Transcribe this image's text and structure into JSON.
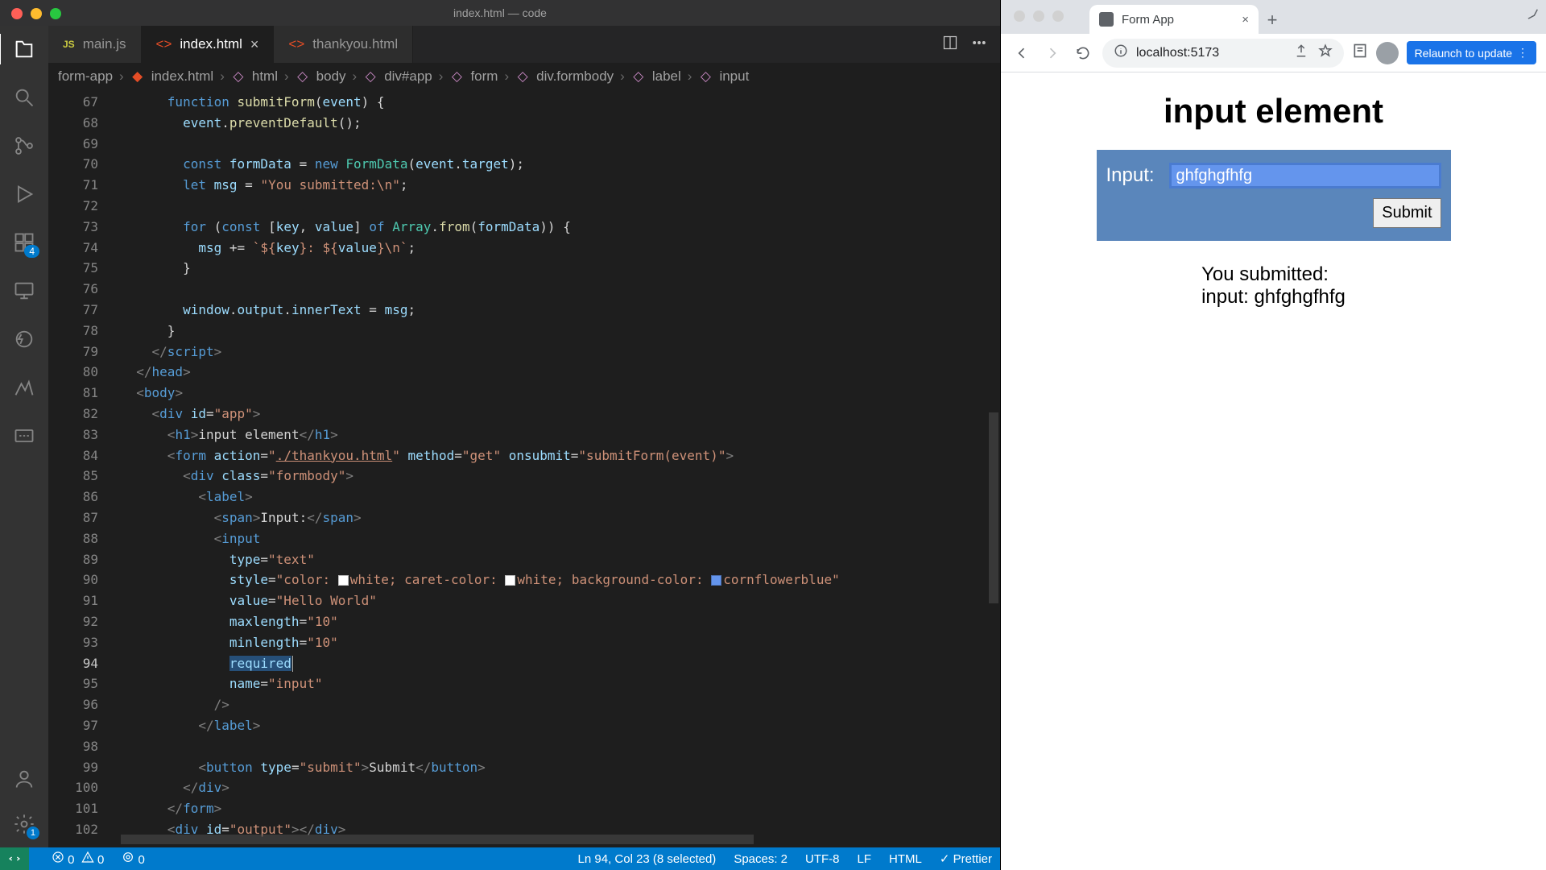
{
  "vscode": {
    "title_left": "index.html",
    "title_right": "code",
    "tabs": [
      {
        "label": "main.js",
        "hint": "JS"
      },
      {
        "label": "index.html"
      },
      {
        "label": "thankyou.html"
      }
    ],
    "ext_badge": "4",
    "settings_badge": "1",
    "crumbs": [
      "form-app",
      "index.html",
      "html",
      "body",
      "div#app",
      "form",
      "div.formbody",
      "label",
      "input"
    ],
    "line_start": 67,
    "current_line": 94,
    "status": {
      "errors": "0",
      "warnings": "0",
      "ports": "0",
      "selection": "Ln 94, Col 23 (8 selected)",
      "spaces": "Spaces: 2",
      "encoding": "UTF-8",
      "eol": "LF",
      "lang": "HTML",
      "formatter": "Prettier"
    }
  },
  "browser": {
    "tab": "Form App",
    "url": "localhost:5173",
    "relaunch": "Relaunch to update",
    "page": {
      "h1": "input element",
      "label": "Input:",
      "value": "ghfghgfhfg",
      "submit": "Submit",
      "output": "You submitted:\ninput: ghfghgfhfg"
    }
  }
}
